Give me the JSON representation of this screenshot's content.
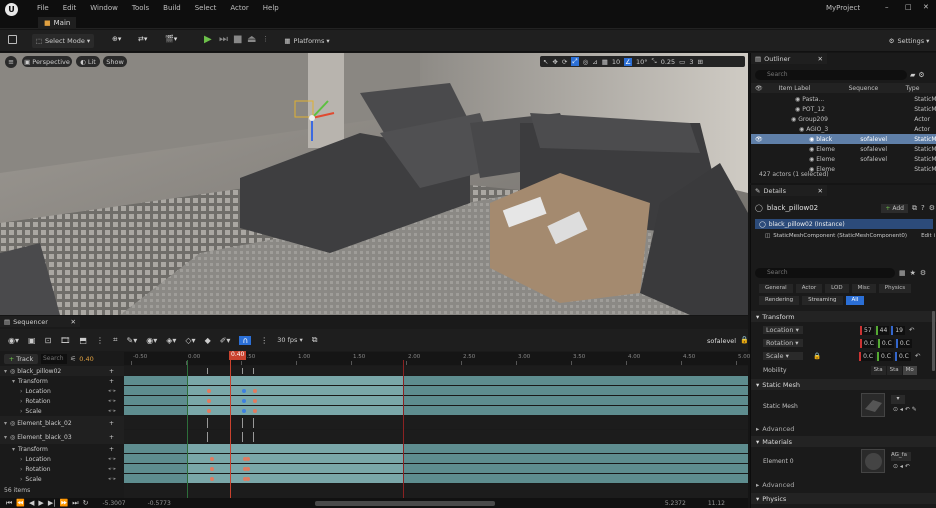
{
  "app": {
    "project": "MyProject",
    "tab": "Main"
  },
  "menu": [
    "File",
    "Edit",
    "Window",
    "Tools",
    "Build",
    "Select",
    "Actor",
    "Help"
  ],
  "toolbar": {
    "select_mode": "Select Mode",
    "platforms": "Platforms",
    "settings": "Settings"
  },
  "viewport": {
    "perspective": "Perspective",
    "lit": "Lit",
    "show": "Show",
    "grid": "10",
    "angle": "10°",
    "scale": "0.25",
    "cam": "3"
  },
  "sequencer": {
    "title": "Sequencer",
    "track_btn": "Track",
    "search_placeholder": "Search",
    "time": "0.40",
    "fps": "30 fps",
    "seq_name": "sofalevel",
    "playhead": "0.40",
    "ruler": [
      "-0.50",
      "0.00",
      "0.50",
      "1.00",
      "1.50",
      "2.00",
      "2.50",
      "3.00",
      "3.50",
      "4.00",
      "4.50",
      "5.00"
    ],
    "tracks": [
      {
        "label": "black_pillow02",
        "level": 0
      },
      {
        "label": "Transform",
        "level": 1
      },
      {
        "label": "Location",
        "level": 2
      },
      {
        "label": "Rotation",
        "level": 2
      },
      {
        "label": "Scale",
        "level": 2
      },
      {
        "label": "Element_black_02",
        "level": 0
      },
      {
        "label": "Element_black_03",
        "level": 0
      },
      {
        "label": "Transform",
        "level": 1
      },
      {
        "label": "Location",
        "level": 2
      },
      {
        "label": "Rotation",
        "level": 2
      },
      {
        "label": "Scale",
        "level": 2
      }
    ],
    "items_count": "56 items",
    "bottom_left": "-5.3007",
    "bottom_left2": "-0.5773",
    "bottom_right": "5.2372",
    "bottom_right2": "11.12"
  },
  "outliner": {
    "title": "Outliner",
    "search_placeholder": "Search",
    "col_label": "Item Label",
    "col_seq": "Sequence",
    "col_type": "Type",
    "rows": [
      {
        "label": "Pasta...",
        "seq": "",
        "type": "StaticM"
      },
      {
        "label": "POT_12",
        "seq": "",
        "type": "StaticM"
      },
      {
        "label": "Group209",
        "seq": "",
        "type": "Actor"
      },
      {
        "label": "AGIO_3",
        "seq": "",
        "type": "Actor"
      },
      {
        "label": "black",
        "seq": "sofalevel",
        "type": "StaticM",
        "selected": true
      },
      {
        "label": "Eleme",
        "seq": "sofalevel",
        "type": "StaticM"
      },
      {
        "label": "Eleme",
        "seq": "sofalevel",
        "type": "StaticM"
      },
      {
        "label": "Eleme",
        "seq": "",
        "type": "StaticM"
      }
    ],
    "status": "427 actors (1 selected)"
  },
  "details": {
    "title": "Details",
    "object": "black_pillow02",
    "add": "Add",
    "instance": "black_pillow02 (Instance)",
    "component": "StaticMeshComponent (StaticMeshComponent0)",
    "edit": "Edit i",
    "search_placeholder": "Search",
    "filters1": [
      "General",
      "Actor",
      "LOD",
      "Misc",
      "Physics"
    ],
    "filters2": [
      "Rendering",
      "Streaming",
      "All"
    ],
    "transform": "Transform",
    "location": {
      "label": "Location",
      "x": "57",
      "y": "44",
      "z": "19"
    },
    "rotation": {
      "label": "Rotation",
      "x": "0.C",
      "y": "0.C",
      "z": "0.C"
    },
    "scale": {
      "label": "Scale",
      "x": "0.C",
      "y": "0.C",
      "z": "0.C"
    },
    "mobility": {
      "label": "Mobility",
      "opts": [
        "Sta",
        "Sta",
        "Mo"
      ]
    },
    "static_mesh_sect": "Static Mesh",
    "static_mesh_label": "Static Mesh",
    "advanced": "Advanced",
    "materials": "Materials",
    "element0": "Element 0",
    "mat_name": "AG_fa",
    "advanced2": "Advanced",
    "physics": "Physics"
  }
}
